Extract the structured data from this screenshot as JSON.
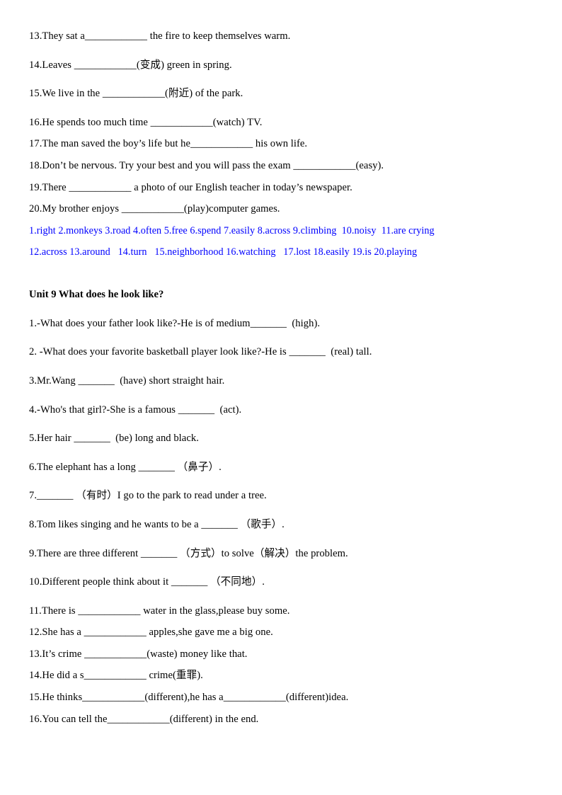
{
  "document": {
    "section_one": {
      "questions": [
        "13.They sat a____________ the fire to keep themselves warm.",
        "14.Leaves ____________(变成) green in spring.",
        "15.We live in the ____________(附近) of the park.",
        "16.He spends too much time ____________(watch) TV.",
        "17.The man saved the boy’s life but he____________ his own life.",
        "18.Don’t be nervous. Try your best and you will pass the exam ____________(easy).",
        "19.There ____________ a photo of our English teacher in today’s newspaper.",
        "20.My brother enjoys ____________(play)computer games."
      ],
      "answer_key": [
        "1.right 2.monkeys 3.road 4.often 5.free 6.spend 7.easily 8.across 9.climbing  10.noisy  11.are crying",
        "12.across 13.around   14.turn   15.neighborhood 16.watching   17.lost 18.easily 19.is 20.playing"
      ],
      "answer_key_color": "#0000ff"
    },
    "section_two": {
      "heading": "Unit 9 What does he look like?",
      "questions": [
        "1.-What does your father look like?-He is of medium_______  (high).",
        "2. -What does your favorite basketball player look like?-He is _______  (real) tall.",
        "3.Mr.Wang _______  (have) short straight hair.",
        "4.-Who's that girl?-She is a famous _______  (act).",
        "5.Her hair _______  (be) long and black.",
        "6.The elephant has a long _______ （鼻子）.",
        "7._______ （有时）I go to the park to read under a tree.",
        "8.Tom likes singing and he wants to be a _______ （歌手）.",
        "9.There are three different _______ （方式）to solve（解决）the problem.",
        "10.Different people think about it _______ （不同地）.",
        "11.There is ____________ water in the glass,please buy some.",
        "12.She has a ____________ apples,she gave me a big one.",
        "13.It’s crime ____________(waste) money like that.",
        "14.He did a s____________ crime(重罪).",
        "15.He thinks____________(different),he has a____________(different)idea.",
        "16.You can tell the____________(different) in the end."
      ]
    }
  }
}
